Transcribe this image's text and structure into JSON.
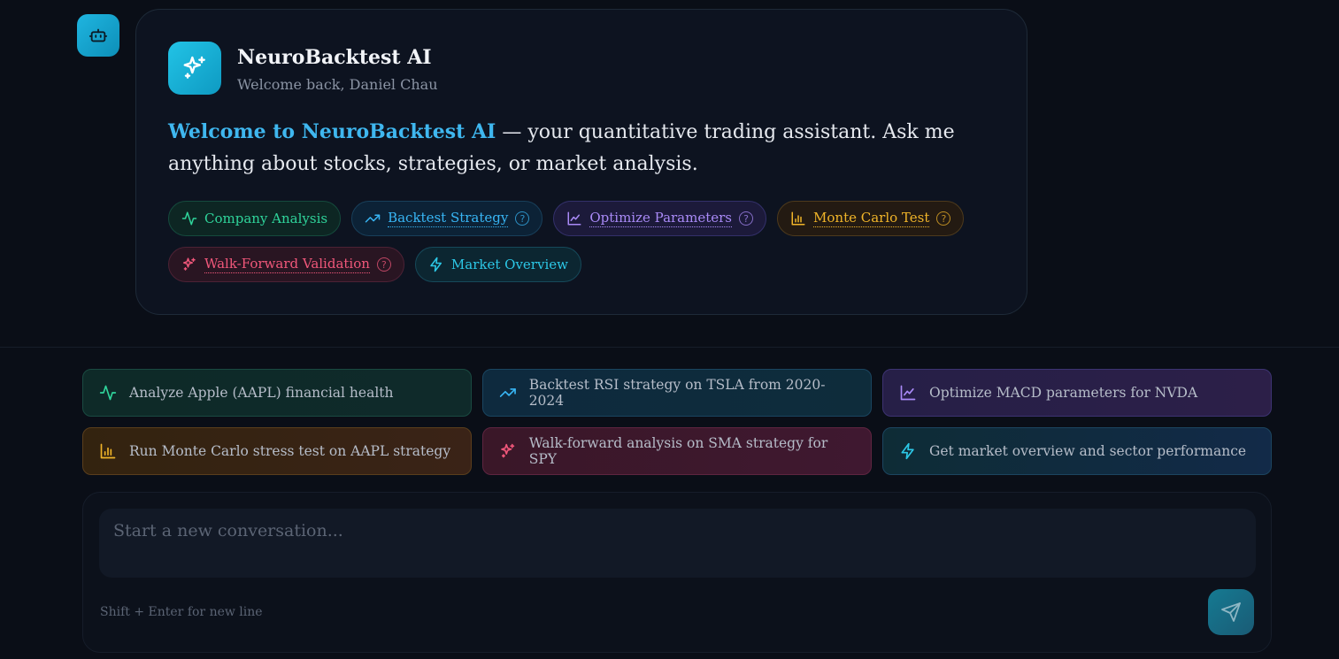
{
  "header": {
    "brand_title": "NeuroBacktest AI",
    "welcome_sub": "Welcome back, Daniel Chau"
  },
  "intro": {
    "highlight": "Welcome to NeuroBacktest AI",
    "rest": " — your quantitative trading assistant. Ask me anything about stocks, strategies, or market analysis."
  },
  "chips": [
    {
      "label": "Company Analysis",
      "icon": "activity-icon",
      "color": "#2fd39a",
      "help": false
    },
    {
      "label": "Backtest Strategy",
      "icon": "trending-up-icon",
      "color": "#38b6f5",
      "help": true
    },
    {
      "label": "Optimize Parameters",
      "icon": "line-chart-icon",
      "color": "#a98af7",
      "help": true
    },
    {
      "label": "Monte Carlo Test",
      "icon": "bar-chart-icon",
      "color": "#f0b429",
      "help": true
    },
    {
      "label": "Walk-Forward Validation",
      "icon": "sparkles-icon",
      "color": "#f0577a",
      "help": true
    },
    {
      "label": "Market Overview",
      "icon": "zap-icon",
      "color": "#2cc7e6",
      "help": false
    }
  ],
  "help_glyph": "?",
  "suggestions": [
    {
      "label": "Analyze Apple (AAPL) financial health",
      "icon": "activity-icon"
    },
    {
      "label": "Backtest RSI strategy on TSLA from 2020-2024",
      "icon": "trending-up-icon"
    },
    {
      "label": "Optimize MACD parameters for NVDA",
      "icon": "line-chart-icon"
    },
    {
      "label": "Run Monte Carlo stress test on AAPL strategy",
      "icon": "bar-chart-icon"
    },
    {
      "label": "Walk-forward analysis on SMA strategy for SPY",
      "icon": "sparkles-icon"
    },
    {
      "label": "Get market overview and sector performance",
      "icon": "zap-icon"
    }
  ],
  "composer": {
    "placeholder": "Start a new conversation...",
    "value": "",
    "hint": "Shift + Enter for new line"
  }
}
